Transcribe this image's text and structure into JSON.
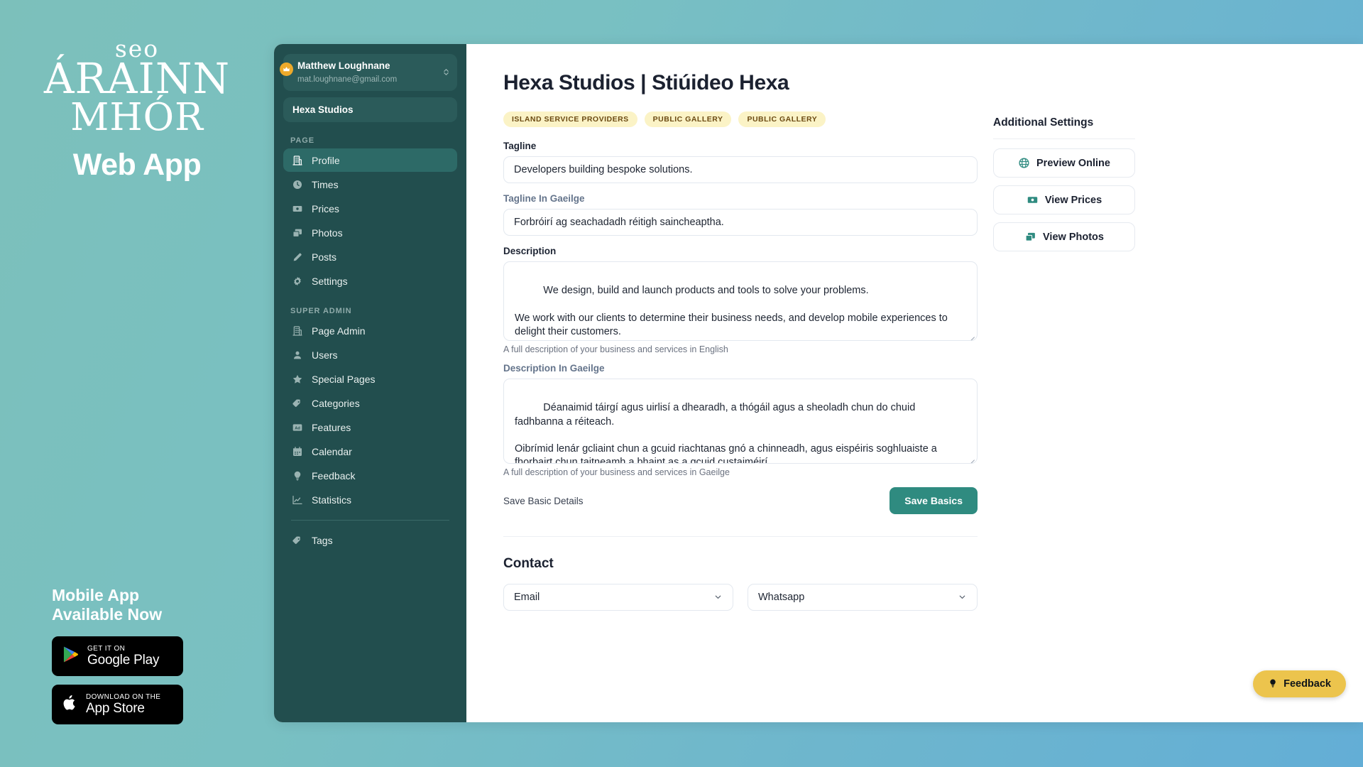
{
  "branding": {
    "logo_line1": "seo",
    "logo_line2": "ÁRAINN",
    "logo_line3": "MHÓR",
    "logo_line4": "Web App",
    "mobile_heading": "Mobile App\nAvailable Now",
    "google_play": {
      "small": "GET IT ON",
      "big": "Google Play",
      "icon": "google-play-icon"
    },
    "app_store": {
      "small": "Download on the",
      "big": "App Store",
      "icon": "apple-icon"
    }
  },
  "sidebar": {
    "user": {
      "name": "Matthew Loughnane",
      "email": "mat.loughnane@gmail.com",
      "badge_icon": "crown-icon",
      "switcher_icon": "chevron-up-down-icon"
    },
    "page_selector": "Hexa Studios",
    "groups": [
      {
        "heading": "PAGE",
        "items": [
          {
            "label": "Profile",
            "icon": "building-icon",
            "active": true
          },
          {
            "label": "Times",
            "icon": "clock-icon",
            "active": false
          },
          {
            "label": "Prices",
            "icon": "money-icon",
            "active": false
          },
          {
            "label": "Photos",
            "icon": "photos-icon",
            "active": false
          },
          {
            "label": "Posts",
            "icon": "pencil-icon",
            "active": false
          },
          {
            "label": "Settings",
            "icon": "gear-icon",
            "active": false
          }
        ]
      },
      {
        "heading": "SUPER ADMIN",
        "items": [
          {
            "label": "Page Admin",
            "icon": "building-icon",
            "active": false
          },
          {
            "label": "Users",
            "icon": "user-icon",
            "active": false
          },
          {
            "label": "Special Pages",
            "icon": "star-icon",
            "active": false
          },
          {
            "label": "Categories",
            "icon": "tags-icon",
            "active": false
          },
          {
            "label": "Features",
            "icon": "ad-icon",
            "active": false
          },
          {
            "label": "Calendar",
            "icon": "calendar-icon",
            "active": false
          },
          {
            "label": "Feedback",
            "icon": "lightbulb-icon",
            "active": false
          },
          {
            "label": "Statistics",
            "icon": "chart-icon",
            "active": false
          }
        ]
      },
      {
        "heading": "",
        "items": [
          {
            "label": "Tags",
            "icon": "tags-icon",
            "active": false
          }
        ]
      }
    ]
  },
  "main": {
    "title": "Hexa Studios | Stiúideo Hexa",
    "badges": [
      "ISLAND SERVICE PROVIDERS",
      "PUBLIC GALLERY",
      "PUBLIC GALLERY"
    ],
    "tagline": {
      "label": "Tagline",
      "value": "Developers building bespoke solutions."
    },
    "tagline_ga": {
      "label": "Tagline In Gaeilge",
      "value": "Forbróirí ag seachadadh réitigh saincheaptha."
    },
    "description": {
      "label": "Description",
      "value": "We design, build and launch products and tools to solve your problems.\n\nWe work with our clients to determine their business needs, and develop mobile experiences to delight their customers.\n\nWe build websites and web apps for businesses across a range of industries including hospitality.",
      "helper": "A full description of your business and services in English"
    },
    "description_ga": {
      "label": "Description In Gaeilge",
      "value": "Déanaimid táirgí agus uirlisí a dhearadh, a thógáil agus a sheoladh chun do chuid fadhbanna a réiteach.\n\nOibrímid lenár gcliaint chun a gcuid riachtanas gnó a chinneadh, agus eispéiris soghluaiste a fhorbairt chun taitneamh a bhaint as a gcuid custaiméirí.",
      "helper": "A full description of your business and services in Gaeilge"
    },
    "save_note": "Save Basic Details",
    "save_button": "Save Basics",
    "contact": {
      "title": "Contact",
      "method_1": "Email",
      "method_2": "Whatsapp"
    }
  },
  "rail": {
    "title": "Additional Settings",
    "buttons": [
      {
        "label": "Preview Online",
        "icon": "globe-icon"
      },
      {
        "label": "View Prices",
        "icon": "money-icon"
      },
      {
        "label": "View Photos",
        "icon": "photos-icon"
      }
    ]
  },
  "feedback_fab": {
    "label": "Feedback",
    "icon": "lightbulb-icon"
  },
  "colors": {
    "sidebar_bg": "#224e4e",
    "sidebar_active": "#2d6a67",
    "accent_teal": "#2f8b80",
    "badge_bg": "#fbf3c6",
    "badge_text": "#6b4a12",
    "feedback_yellow": "#ecc44d"
  }
}
